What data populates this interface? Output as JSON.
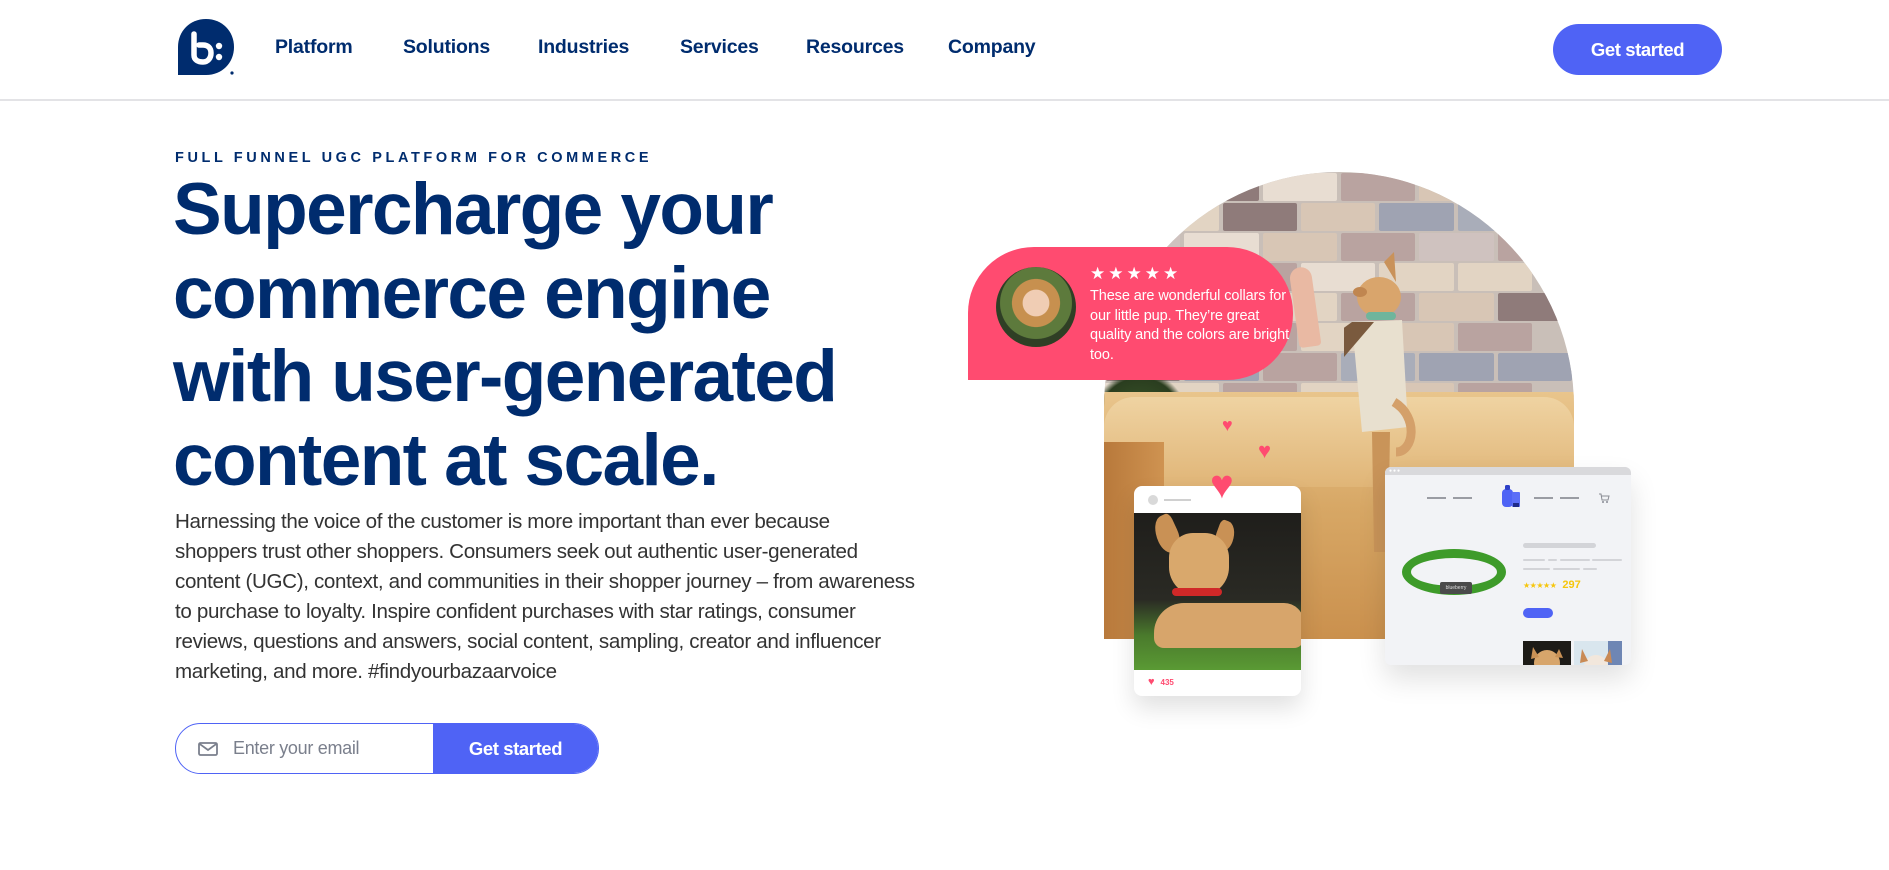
{
  "brand": {
    "logo_label": "b:",
    "logo_color": "#002c6e"
  },
  "header": {
    "nav": [
      "Platform",
      "Solutions",
      "Industries",
      "Services",
      "Resources",
      "Company"
    ],
    "cta_label": "Get started"
  },
  "hero": {
    "eyebrow": "FULL FUNNEL UGC PLATFORM FOR COMMERCE",
    "headline_lines": [
      "Supercharge your",
      "commerce engine",
      "with user-generated",
      "content at scale."
    ],
    "paragraph": "Harnessing the voice of the customer is more important than ever because shoppers trust other shoppers. Consumers seek out authentic user-generated content (UGC), context, and communities in their shopper journey – from awareness to purchase to loyalty. Inspire confident purchases with star ratings, consumer reviews, questions and answers, social content, sampling, creator and influencer marketing, and more. #findyourbazaarvoice",
    "email_form": {
      "icon": "mail-icon",
      "placeholder": "Enter your email",
      "value": "",
      "submit_label": "Get started"
    }
  },
  "illustration": {
    "review": {
      "rating": 5,
      "stars": "★★★★★",
      "text": "These are wonderful collars for our little pup. They’re great quality and the colors are bright too."
    },
    "social_post": {
      "likes": "435",
      "like_icon": "heart-icon"
    },
    "product": {
      "stars": "★★★★★",
      "review_count": "297",
      "collar_tag": "blueberry"
    },
    "colors": {
      "accent": "#4f63f5",
      "review_pink": "#ff4b70",
      "navy": "#002c6e",
      "rating_yellow": "#f6c60d"
    }
  }
}
